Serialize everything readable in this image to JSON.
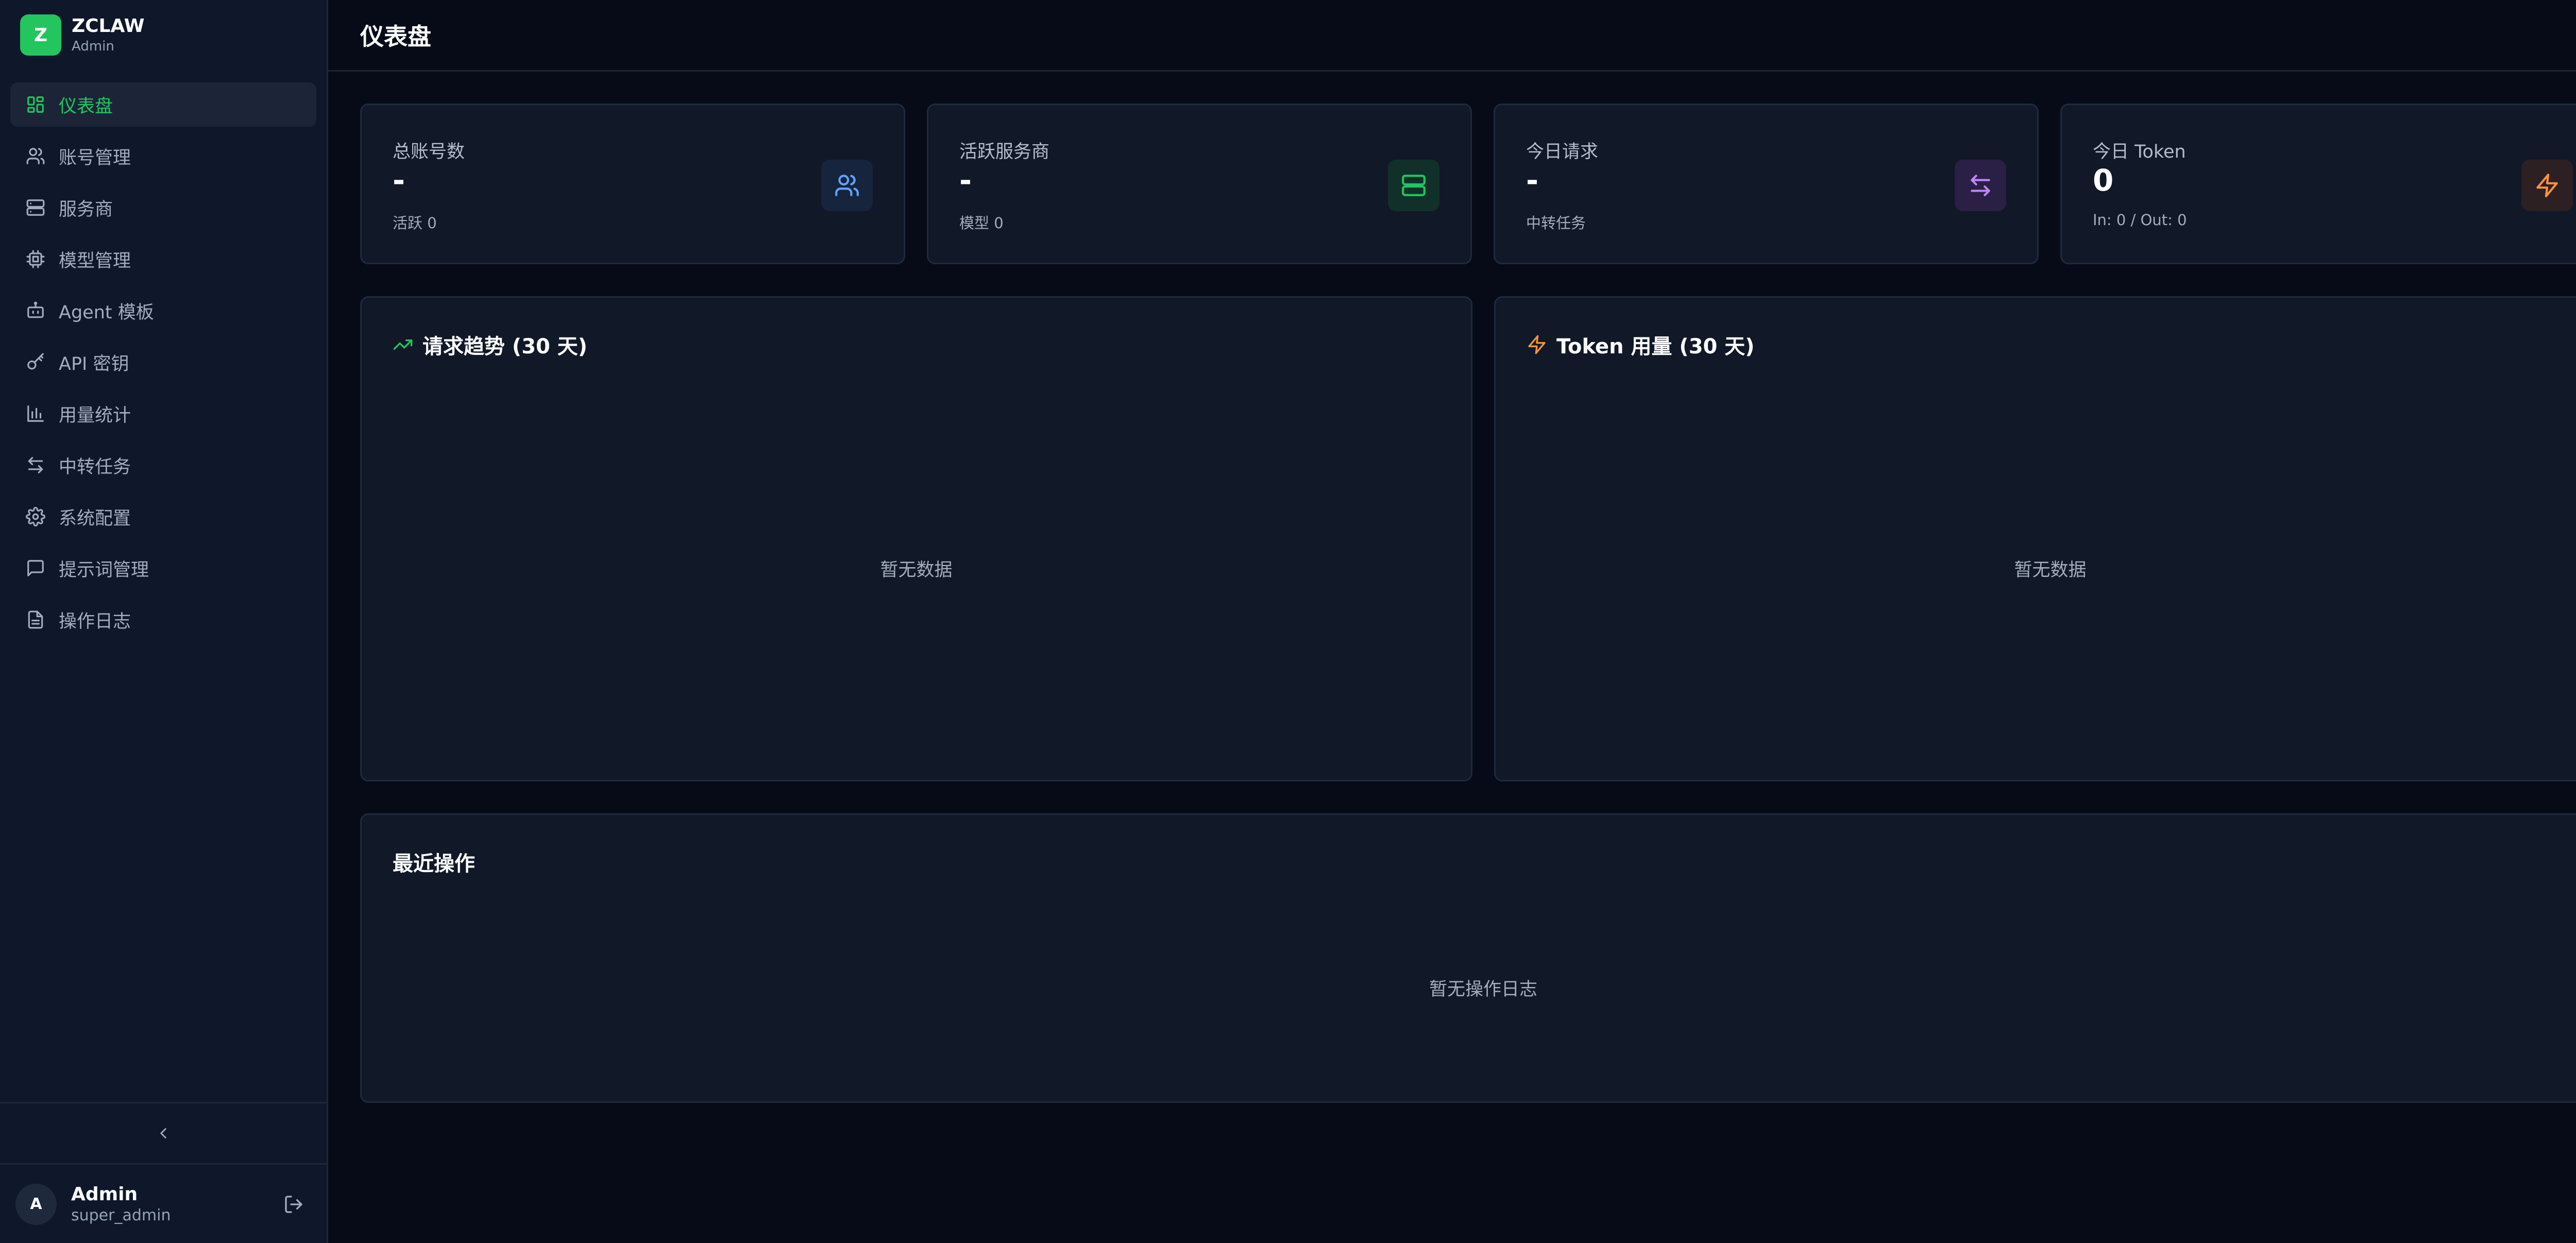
{
  "brand": {
    "logo_letter": "Z",
    "name": "ZCLAW",
    "role": "Admin"
  },
  "nav": {
    "items": [
      {
        "label": "仪表盘",
        "icon": "dashboard-icon",
        "active": true
      },
      {
        "label": "账号管理",
        "icon": "users-icon"
      },
      {
        "label": "服务商",
        "icon": "server-icon"
      },
      {
        "label": "模型管理",
        "icon": "cpu-icon"
      },
      {
        "label": "Agent 模板",
        "icon": "bot-icon"
      },
      {
        "label": "API 密钥",
        "icon": "key-icon"
      },
      {
        "label": "用量统计",
        "icon": "bar-chart-icon"
      },
      {
        "label": "中转任务",
        "icon": "arrows-exchange-icon"
      },
      {
        "label": "系统配置",
        "icon": "gear-icon"
      },
      {
        "label": "提示词管理",
        "icon": "message-square-icon"
      },
      {
        "label": "操作日志",
        "icon": "file-text-icon"
      }
    ]
  },
  "user": {
    "avatar_letter": "A",
    "name": "Admin",
    "role": "super_admin"
  },
  "header": {
    "title": "仪表盘"
  },
  "stats": [
    {
      "label": "总账号数",
      "value": "-",
      "sub": "活跃 0",
      "icon": "users-icon",
      "color": "#60a5fa",
      "bg": "#17243d"
    },
    {
      "label": "活跃服务商",
      "value": "-",
      "sub": "模型 0",
      "icon": "server-icon",
      "color": "#22c55e",
      "bg": "#12302a"
    },
    {
      "label": "今日请求",
      "value": "-",
      "sub": "中转任务",
      "icon": "arrows-exchange-icon",
      "color": "#c084fc",
      "bg": "#2a1f45"
    },
    {
      "label": "今日 Token",
      "value": "0",
      "sub": "In: 0 / Out: 0",
      "icon": "zap-icon",
      "color": "#fb923c",
      "bg": "#2d2023"
    }
  ],
  "charts": {
    "requests": {
      "title": "请求趋势 (30 天)",
      "empty": "暂无数据",
      "icon_color": "#22c55e"
    },
    "tokens": {
      "title": "Token 用量 (30 天)",
      "empty": "暂无数据",
      "icon_color": "#fb923c"
    }
  },
  "recent": {
    "title": "最近操作",
    "empty": "暂无操作日志"
  }
}
